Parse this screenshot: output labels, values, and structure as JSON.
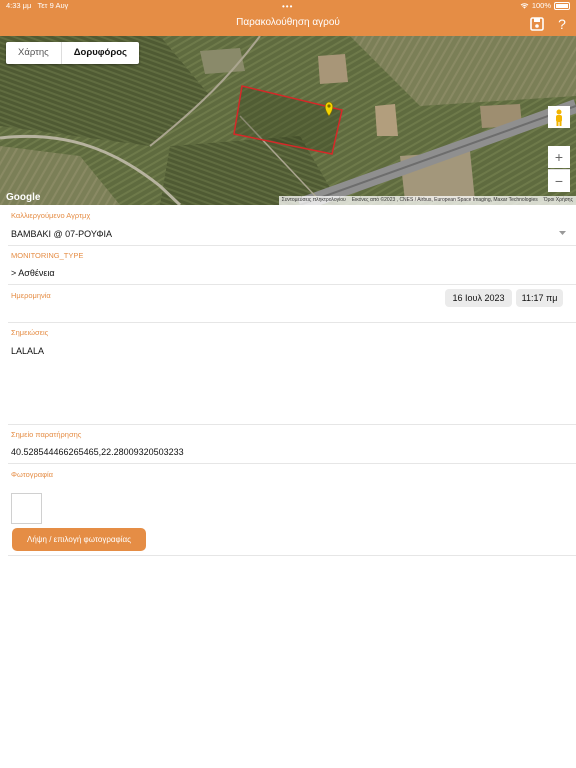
{
  "status": {
    "time": "4:33 μμ",
    "date": "Τετ 9 Αυγ",
    "battery": "100%"
  },
  "header": {
    "title": "Παρακολούθηση αγρού",
    "save_icon": "save-icon",
    "help_icon": "question-icon"
  },
  "map": {
    "tabs": [
      "Χάρτης",
      "Δορυφόρος"
    ],
    "active_tab": "Δορυφόρος",
    "logo": "Google",
    "attribution": [
      "Συντομεύσεις πληκτρολογίου",
      "Εικόνες από ©2023 , CNES / Airbus, European Space Imaging, Maxar Technologies",
      "Όροι Χρήσης"
    ],
    "zoom_in": "+",
    "zoom_out": "−"
  },
  "form": {
    "crop": {
      "label": "Καλλιεργούμενο Αγρτμχ",
      "value": "ΒΑΜΒΑΚΙ @ 07-ΡΟΥΦΙΑ"
    },
    "monitoring": {
      "label": "MONITORING_TYPE",
      "value": "> Ασθένεια"
    },
    "date": {
      "label": "Ημερομηνία",
      "date_value": "16 Ιουλ 2023",
      "time_value": "11:17 πμ"
    },
    "notes": {
      "label": "Σημειώσεις",
      "value": "LALALA"
    },
    "point": {
      "label": "Σημείο παρατήρησης",
      "value": "40.528544466265465,22.28009320503233"
    },
    "photo": {
      "label": "Φωτογραφία",
      "button": "Λήψη / επιλογή φωτογραφίας"
    }
  },
  "colors": {
    "accent": "#e58d45",
    "field_outline": "#d62828",
    "marker": "#f5d400"
  }
}
